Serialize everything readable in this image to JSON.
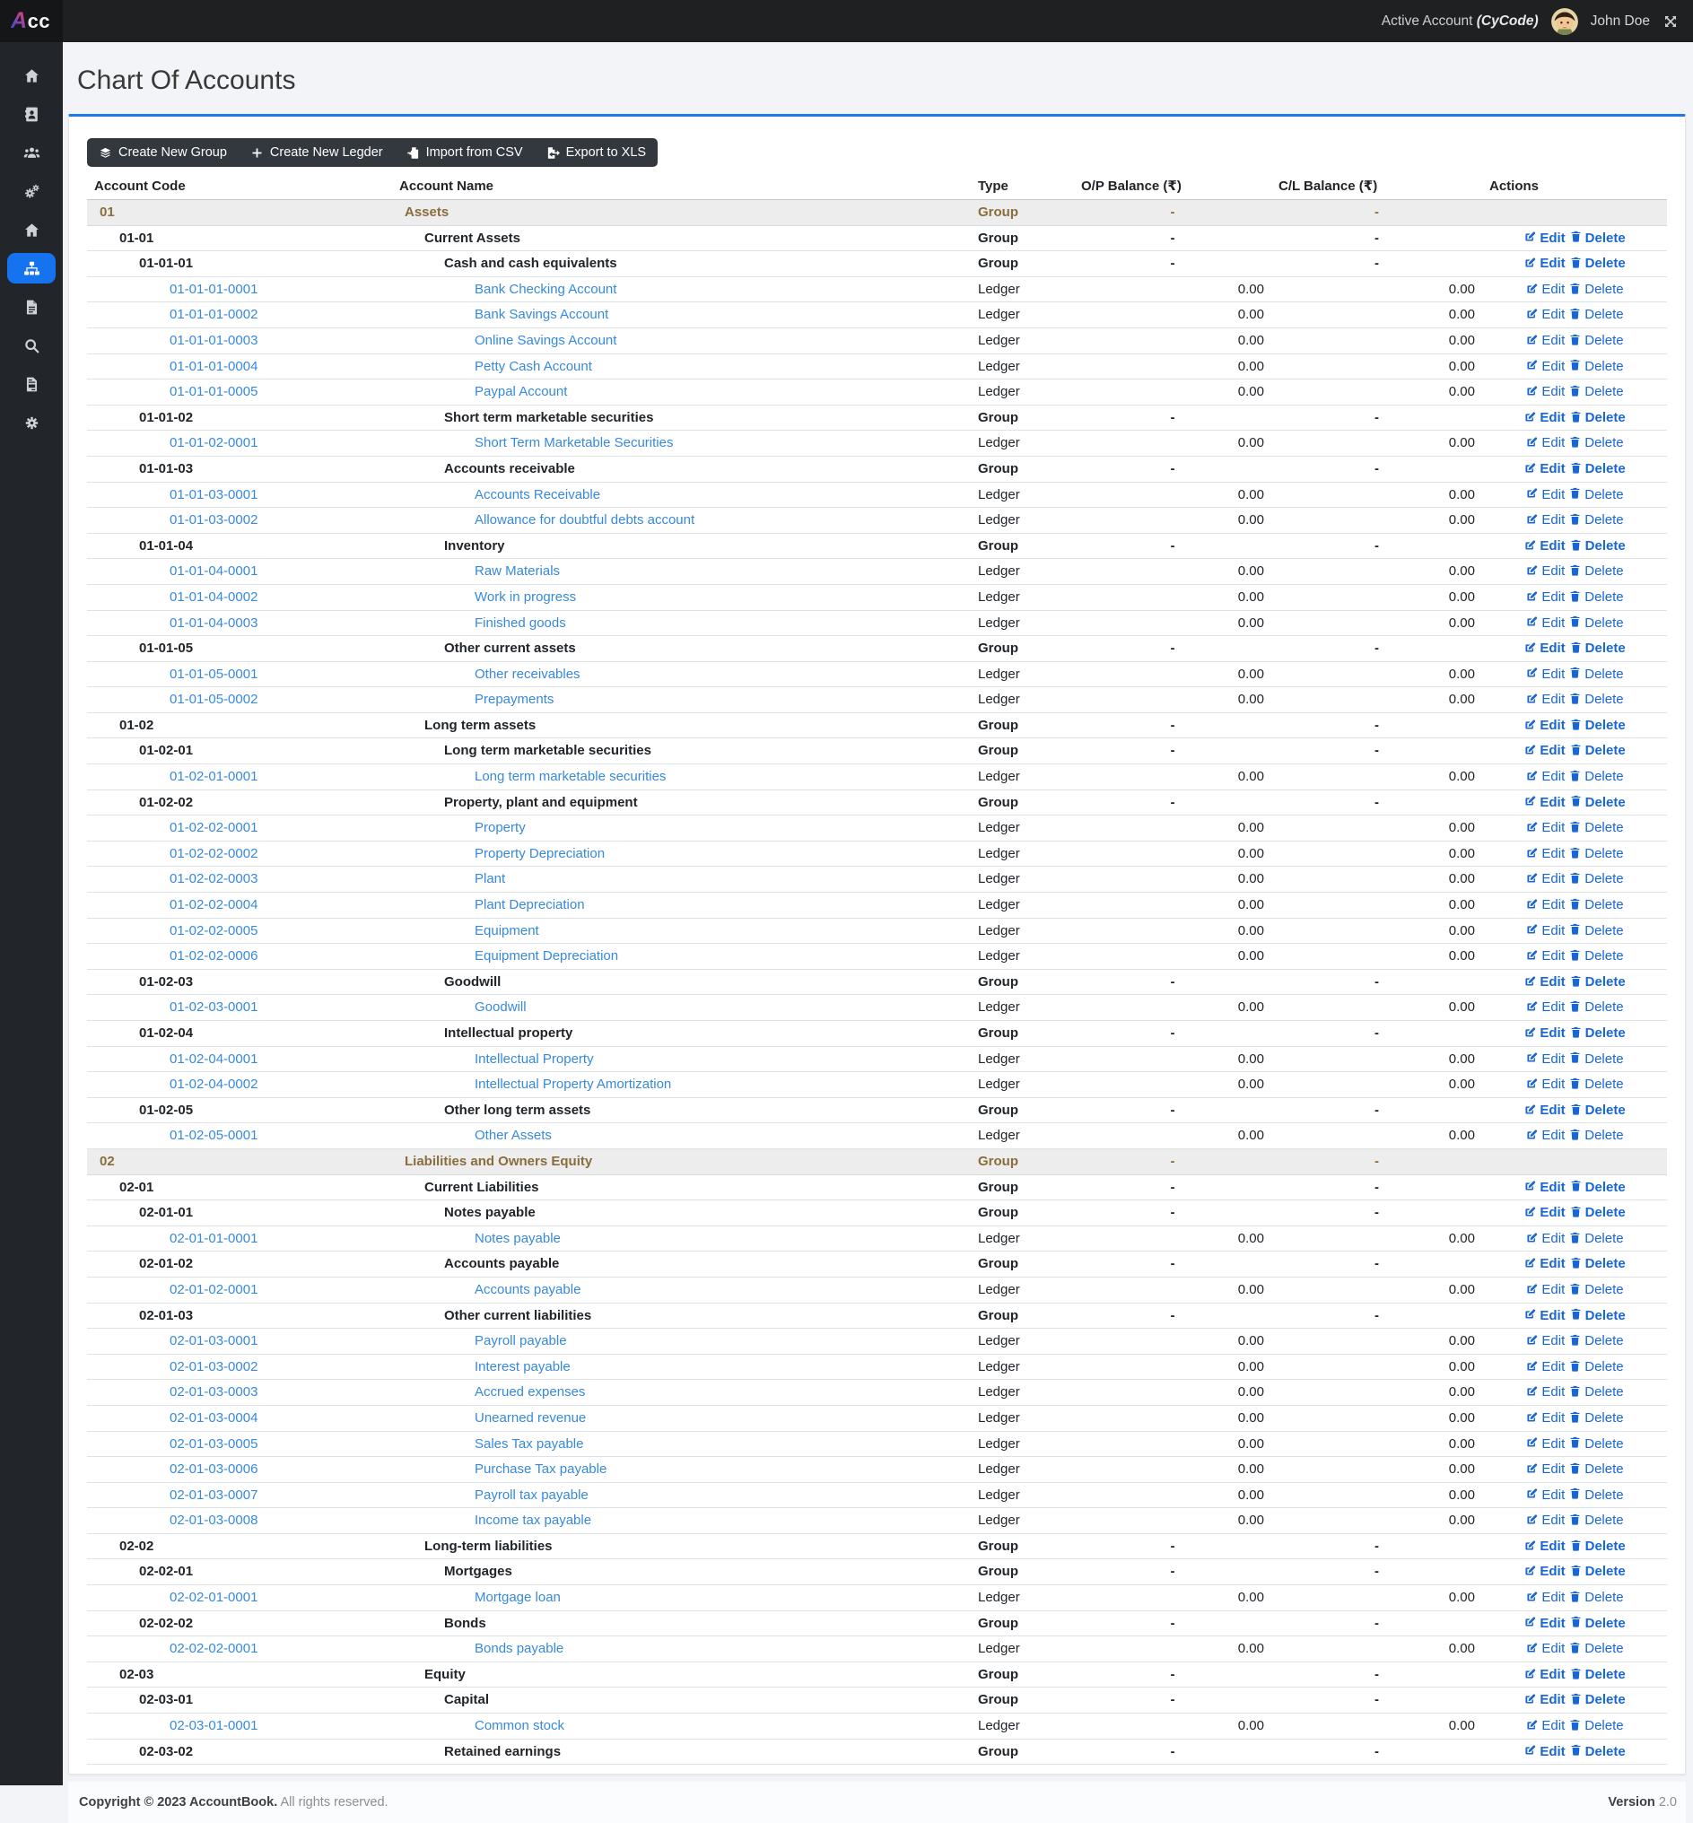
{
  "topbar": {
    "brand_initial": "A",
    "brand_rest": "cc",
    "active_account_label": "Active Account",
    "active_account_code": "(CyCode)",
    "user_name": "John Doe",
    "fullscreen_icon": "expand-arrows-icon",
    "avatar_icon": "user-avatar"
  },
  "sidebar": {
    "items": [
      {
        "id": "home",
        "icon": "home",
        "active": false
      },
      {
        "id": "contacts",
        "icon": "address-book",
        "active": false
      },
      {
        "id": "users",
        "icon": "users",
        "active": false
      },
      {
        "id": "preferences",
        "icon": "cogs",
        "active": false
      },
      {
        "id": "dashboard",
        "icon": "home",
        "active": false
      },
      {
        "id": "chart-of-accounts",
        "icon": "sitemap",
        "active": true
      },
      {
        "id": "documents",
        "icon": "file",
        "active": false
      },
      {
        "id": "search",
        "icon": "search",
        "active": false
      },
      {
        "id": "reports",
        "icon": "file-invoice",
        "active": false
      },
      {
        "id": "settings",
        "icon": "cog",
        "active": false
      }
    ]
  },
  "page": {
    "title": "Chart Of Accounts"
  },
  "toolbar": {
    "buttons": [
      {
        "id": "create-new-group",
        "icon": "layer-group",
        "label": "Create New Group"
      },
      {
        "id": "create-new-ledger",
        "icon": "plus",
        "label": "Create New Legder"
      },
      {
        "id": "import-from-csv",
        "icon": "file-import",
        "label": "Import from CSV"
      },
      {
        "id": "export-to-xls",
        "icon": "file-export",
        "label": "Export to XLS"
      }
    ]
  },
  "table": {
    "columns": [
      "Account Code",
      "Account Name",
      "Type",
      "O/P Balance (₹)",
      "C/L Balance (₹)",
      "Actions"
    ],
    "edit_label": "Edit",
    "delete_label": "Delete",
    "rows": [
      {
        "code": "01",
        "name": "Assets",
        "type": "Group",
        "op": "-",
        "cl": "-"
      },
      {
        "code": "01-01",
        "name": "Current Assets",
        "type": "Group",
        "op": "-",
        "cl": "-"
      },
      {
        "code": "01-01-01",
        "name": "Cash and cash equivalents",
        "type": "Group",
        "op": "-",
        "cl": "-"
      },
      {
        "code": "01-01-01-0001",
        "name": "Bank Checking Account",
        "type": "Ledger",
        "op": "0.00",
        "cl": "0.00"
      },
      {
        "code": "01-01-01-0002",
        "name": "Bank Savings Account",
        "type": "Ledger",
        "op": "0.00",
        "cl": "0.00"
      },
      {
        "code": "01-01-01-0003",
        "name": "Online Savings Account",
        "type": "Ledger",
        "op": "0.00",
        "cl": "0.00"
      },
      {
        "code": "01-01-01-0004",
        "name": "Petty Cash Account",
        "type": "Ledger",
        "op": "0.00",
        "cl": "0.00"
      },
      {
        "code": "01-01-01-0005",
        "name": "Paypal Account",
        "type": "Ledger",
        "op": "0.00",
        "cl": "0.00"
      },
      {
        "code": "01-01-02",
        "name": "Short term marketable securities",
        "type": "Group",
        "op": "-",
        "cl": "-"
      },
      {
        "code": "01-01-02-0001",
        "name": "Short Term Marketable Securities",
        "type": "Ledger",
        "op": "0.00",
        "cl": "0.00"
      },
      {
        "code": "01-01-03",
        "name": "Accounts receivable",
        "type": "Group",
        "op": "-",
        "cl": "-"
      },
      {
        "code": "01-01-03-0001",
        "name": "Accounts Receivable",
        "type": "Ledger",
        "op": "0.00",
        "cl": "0.00"
      },
      {
        "code": "01-01-03-0002",
        "name": "Allowance for doubtful debts account",
        "type": "Ledger",
        "op": "0.00",
        "cl": "0.00"
      },
      {
        "code": "01-01-04",
        "name": "Inventory",
        "type": "Group",
        "op": "-",
        "cl": "-"
      },
      {
        "code": "01-01-04-0001",
        "name": "Raw Materials",
        "type": "Ledger",
        "op": "0.00",
        "cl": "0.00"
      },
      {
        "code": "01-01-04-0002",
        "name": "Work in progress",
        "type": "Ledger",
        "op": "0.00",
        "cl": "0.00"
      },
      {
        "code": "01-01-04-0003",
        "name": "Finished goods",
        "type": "Ledger",
        "op": "0.00",
        "cl": "0.00"
      },
      {
        "code": "01-01-05",
        "name": "Other current assets",
        "type": "Group",
        "op": "-",
        "cl": "-"
      },
      {
        "code": "01-01-05-0001",
        "name": "Other receivables",
        "type": "Ledger",
        "op": "0.00",
        "cl": "0.00"
      },
      {
        "code": "01-01-05-0002",
        "name": "Prepayments",
        "type": "Ledger",
        "op": "0.00",
        "cl": "0.00"
      },
      {
        "code": "01-02",
        "name": "Long term assets",
        "type": "Group",
        "op": "-",
        "cl": "-"
      },
      {
        "code": "01-02-01",
        "name": "Long term marketable securities",
        "type": "Group",
        "op": "-",
        "cl": "-"
      },
      {
        "code": "01-02-01-0001",
        "name": "Long term marketable securities",
        "type": "Ledger",
        "op": "0.00",
        "cl": "0.00"
      },
      {
        "code": "01-02-02",
        "name": "Property, plant and equipment",
        "type": "Group",
        "op": "-",
        "cl": "-"
      },
      {
        "code": "01-02-02-0001",
        "name": "Property",
        "type": "Ledger",
        "op": "0.00",
        "cl": "0.00"
      },
      {
        "code": "01-02-02-0002",
        "name": "Property Depreciation",
        "type": "Ledger",
        "op": "0.00",
        "cl": "0.00"
      },
      {
        "code": "01-02-02-0003",
        "name": "Plant",
        "type": "Ledger",
        "op": "0.00",
        "cl": "0.00"
      },
      {
        "code": "01-02-02-0004",
        "name": "Plant Depreciation",
        "type": "Ledger",
        "op": "0.00",
        "cl": "0.00"
      },
      {
        "code": "01-02-02-0005",
        "name": "Equipment",
        "type": "Ledger",
        "op": "0.00",
        "cl": "0.00"
      },
      {
        "code": "01-02-02-0006",
        "name": "Equipment Depreciation",
        "type": "Ledger",
        "op": "0.00",
        "cl": "0.00"
      },
      {
        "code": "01-02-03",
        "name": "Goodwill",
        "type": "Group",
        "op": "-",
        "cl": "-"
      },
      {
        "code": "01-02-03-0001",
        "name": "Goodwill",
        "type": "Ledger",
        "op": "0.00",
        "cl": "0.00"
      },
      {
        "code": "01-02-04",
        "name": "Intellectual property",
        "type": "Group",
        "op": "-",
        "cl": "-"
      },
      {
        "code": "01-02-04-0001",
        "name": "Intellectual Property",
        "type": "Ledger",
        "op": "0.00",
        "cl": "0.00"
      },
      {
        "code": "01-02-04-0002",
        "name": "Intellectual Property Amortization",
        "type": "Ledger",
        "op": "0.00",
        "cl": "0.00"
      },
      {
        "code": "01-02-05",
        "name": "Other long term assets",
        "type": "Group",
        "op": "-",
        "cl": "-"
      },
      {
        "code": "01-02-05-0001",
        "name": "Other Assets",
        "type": "Ledger",
        "op": "0.00",
        "cl": "0.00"
      },
      {
        "code": "02",
        "name": "Liabilities and Owners Equity",
        "type": "Group",
        "op": "-",
        "cl": "-"
      },
      {
        "code": "02-01",
        "name": "Current Liabilities",
        "type": "Group",
        "op": "-",
        "cl": "-"
      },
      {
        "code": "02-01-01",
        "name": "Notes payable",
        "type": "Group",
        "op": "-",
        "cl": "-"
      },
      {
        "code": "02-01-01-0001",
        "name": "Notes payable",
        "type": "Ledger",
        "op": "0.00",
        "cl": "0.00"
      },
      {
        "code": "02-01-02",
        "name": "Accounts payable",
        "type": "Group",
        "op": "-",
        "cl": "-"
      },
      {
        "code": "02-01-02-0001",
        "name": "Accounts payable",
        "type": "Ledger",
        "op": "0.00",
        "cl": "0.00"
      },
      {
        "code": "02-01-03",
        "name": "Other current liabilities",
        "type": "Group",
        "op": "-",
        "cl": "-"
      },
      {
        "code": "02-01-03-0001",
        "name": "Payroll payable",
        "type": "Ledger",
        "op": "0.00",
        "cl": "0.00"
      },
      {
        "code": "02-01-03-0002",
        "name": "Interest payable",
        "type": "Ledger",
        "op": "0.00",
        "cl": "0.00"
      },
      {
        "code": "02-01-03-0003",
        "name": "Accrued expenses",
        "type": "Ledger",
        "op": "0.00",
        "cl": "0.00"
      },
      {
        "code": "02-01-03-0004",
        "name": "Unearned revenue",
        "type": "Ledger",
        "op": "0.00",
        "cl": "0.00"
      },
      {
        "code": "02-01-03-0005",
        "name": "Sales Tax payable",
        "type": "Ledger",
        "op": "0.00",
        "cl": "0.00"
      },
      {
        "code": "02-01-03-0006",
        "name": "Purchase Tax payable",
        "type": "Ledger",
        "op": "0.00",
        "cl": "0.00"
      },
      {
        "code": "02-01-03-0007",
        "name": "Payroll tax payable",
        "type": "Ledger",
        "op": "0.00",
        "cl": "0.00"
      },
      {
        "code": "02-01-03-0008",
        "name": "Income tax payable",
        "type": "Ledger",
        "op": "0.00",
        "cl": "0.00"
      },
      {
        "code": "02-02",
        "name": "Long-term liabilities",
        "type": "Group",
        "op": "-",
        "cl": "-"
      },
      {
        "code": "02-02-01",
        "name": "Mortgages",
        "type": "Group",
        "op": "-",
        "cl": "-"
      },
      {
        "code": "02-02-01-0001",
        "name": "Mortgage loan",
        "type": "Ledger",
        "op": "0.00",
        "cl": "0.00"
      },
      {
        "code": "02-02-02",
        "name": "Bonds",
        "type": "Group",
        "op": "-",
        "cl": "-"
      },
      {
        "code": "02-02-02-0001",
        "name": "Bonds payable",
        "type": "Ledger",
        "op": "0.00",
        "cl": "0.00"
      },
      {
        "code": "02-03",
        "name": "Equity",
        "type": "Group",
        "op": "-",
        "cl": "-"
      },
      {
        "code": "02-03-01",
        "name": "Capital",
        "type": "Group",
        "op": "-",
        "cl": "-"
      },
      {
        "code": "02-03-01-0001",
        "name": "Common stock",
        "type": "Ledger",
        "op": "0.00",
        "cl": "0.00"
      },
      {
        "code": "02-03-02",
        "name": "Retained earnings",
        "type": "Group",
        "op": "-",
        "cl": "-"
      }
    ]
  },
  "footer": {
    "copyright_bold": "Copyright © 2023 AccountBook.",
    "copyright_rest": "All rights reserved.",
    "version_label": "Version",
    "version_value": "2.0"
  },
  "colors": {
    "accent": "#1573f0",
    "link_blue": "#3789dc",
    "action_blue": "#1866d6",
    "group_row_text": "#8a6d3b",
    "card_top_border": "#1b79e8",
    "topbar_bg": "#1e2022",
    "sidebar_bg": "#22262b",
    "toolbar_bg": "#33383e"
  }
}
